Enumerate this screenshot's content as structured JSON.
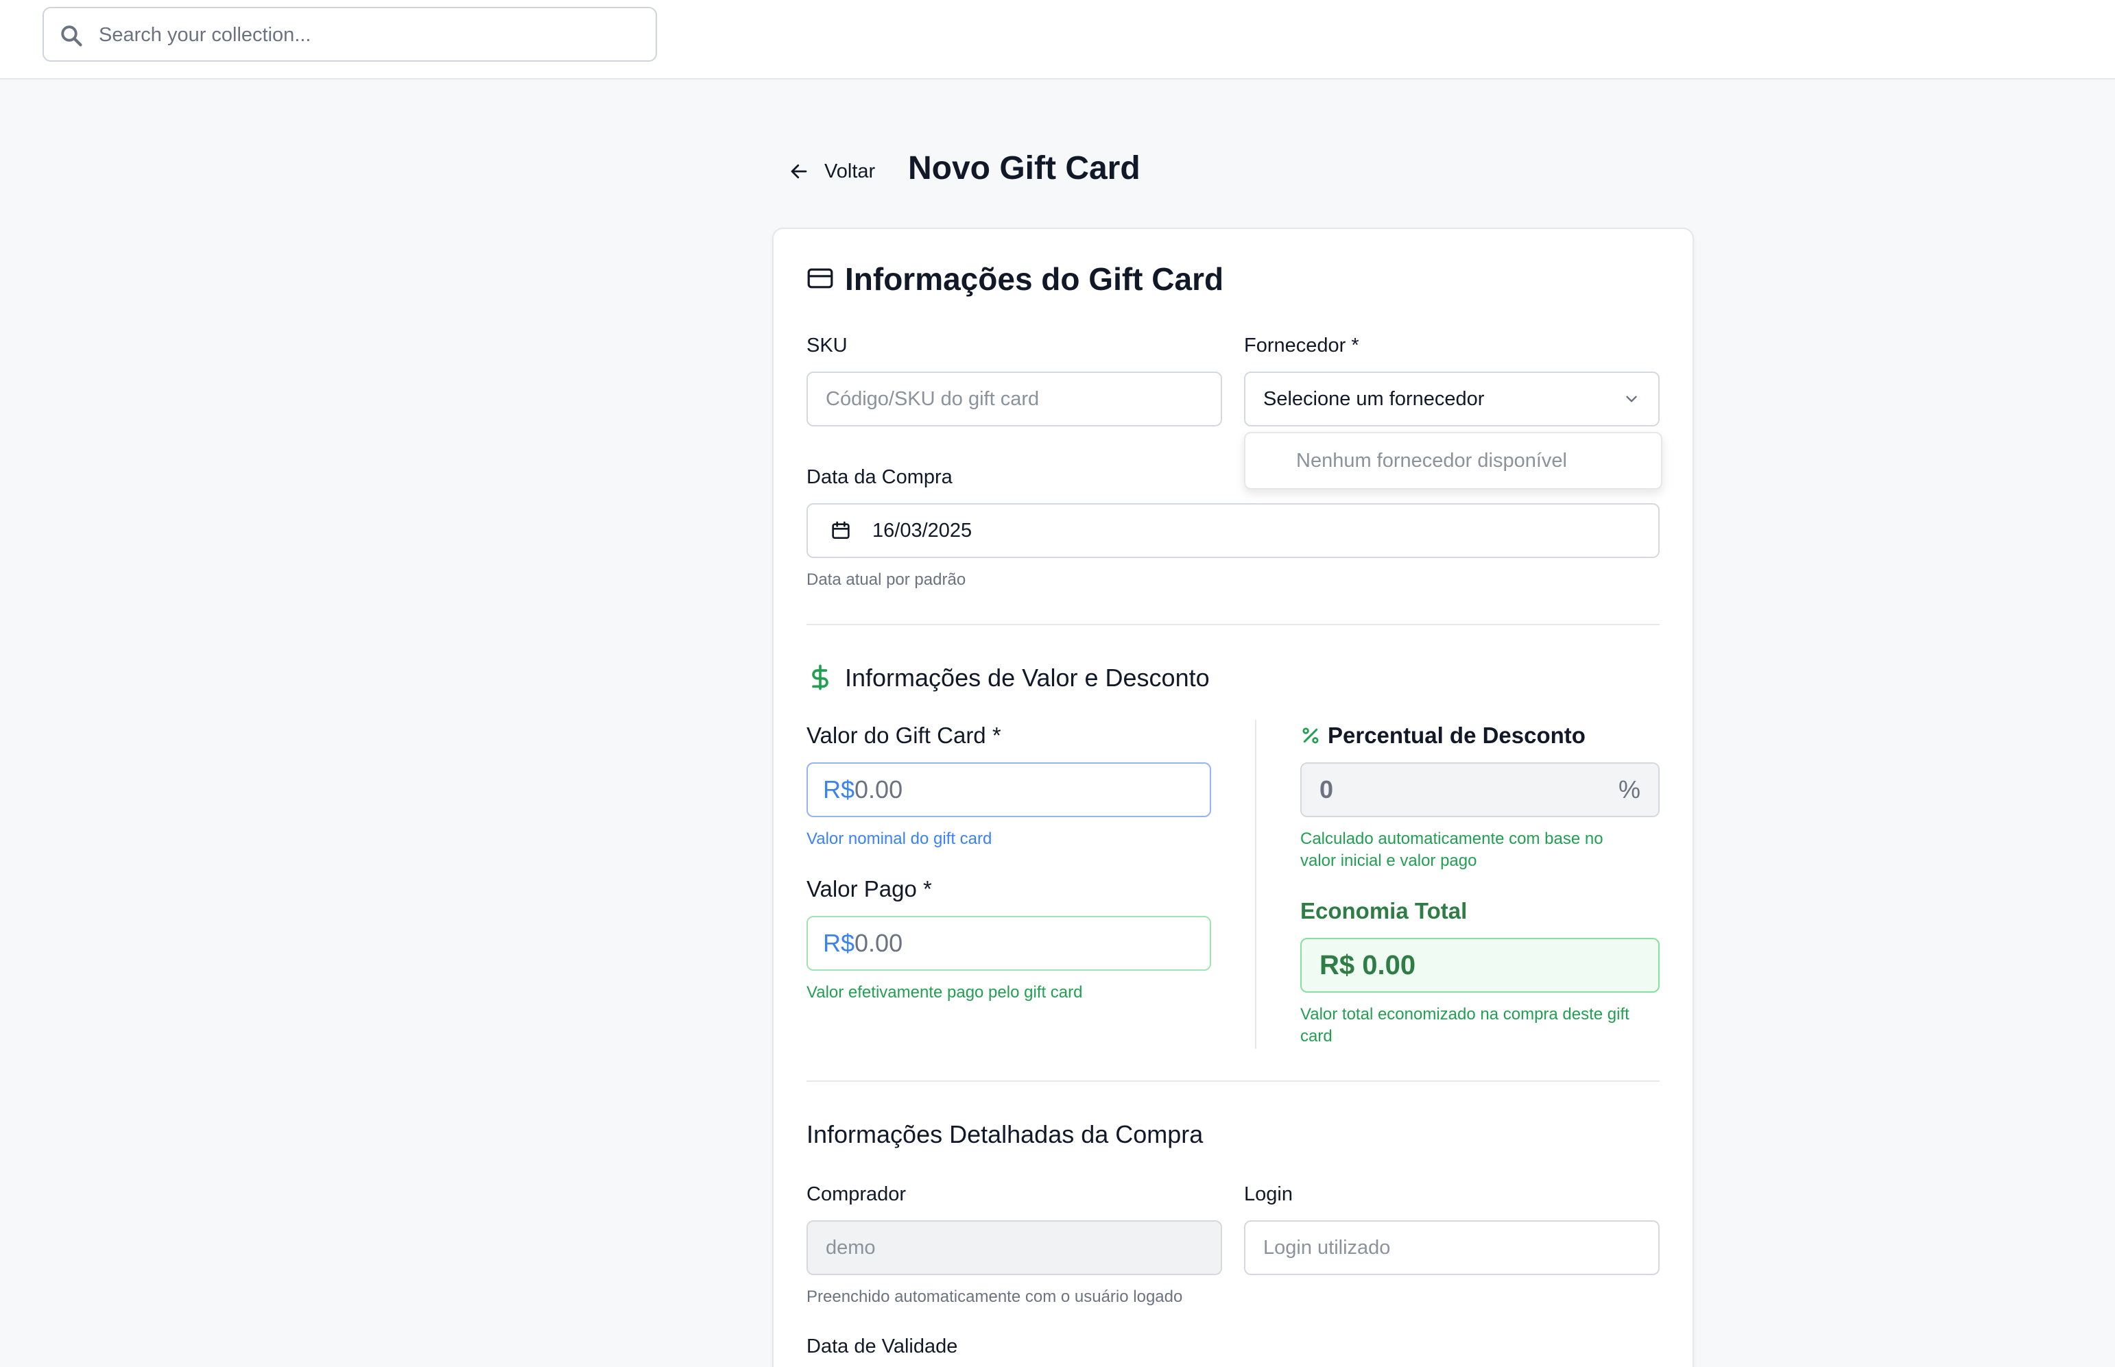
{
  "search": {
    "placeholder": "Search your collection..."
  },
  "header": {
    "back_label": "Voltar",
    "title": "Novo Gift Card"
  },
  "section_giftcard": {
    "title": "Informações do Gift Card",
    "sku_label": "SKU",
    "sku_placeholder": "Código/SKU do gift card",
    "supplier_label": "Fornecedor *",
    "supplier_selected": "Selecione um fornecedor",
    "supplier_empty_option": "Nenhum fornecedor disponível",
    "purchase_date_label": "Data da Compra",
    "purchase_date_value": "16/03/2025",
    "purchase_date_help": "Data atual por padrão"
  },
  "section_value": {
    "title": "Informações de Valor e Desconto",
    "giftcard_value_label": "Valor do Gift Card *",
    "currency_prefix": "R$",
    "giftcard_value_placeholder": "0.00",
    "giftcard_value_help": "Valor nominal do gift card",
    "paid_value_label": "Valor Pago *",
    "paid_value_placeholder": "0.00",
    "paid_value_help": "Valor efetivamente pago pelo gift card",
    "discount_label": "Percentual de Desconto",
    "discount_value": "0",
    "discount_sign": "%",
    "discount_help_1": "Calculado automaticamente com base no",
    "discount_help_2": "valor inicial e valor pago",
    "savings_label": "Economia Total",
    "savings_value": "R$ 0.00",
    "savings_help_1": "Valor total economizado na compra deste gift",
    "savings_help_2": "card"
  },
  "section_purchase": {
    "title": "Informações Detalhadas da Compra",
    "buyer_label": "Comprador",
    "buyer_value": "demo",
    "buyer_help": "Preenchido automaticamente com o usuário logado",
    "login_label": "Login",
    "login_placeholder": "Login utilizado",
    "expiry_label": "Data de Validade"
  },
  "colors": {
    "accent_blue": "#3b82f6",
    "accent_green": "#22a052",
    "background": "#f7f8fa"
  }
}
